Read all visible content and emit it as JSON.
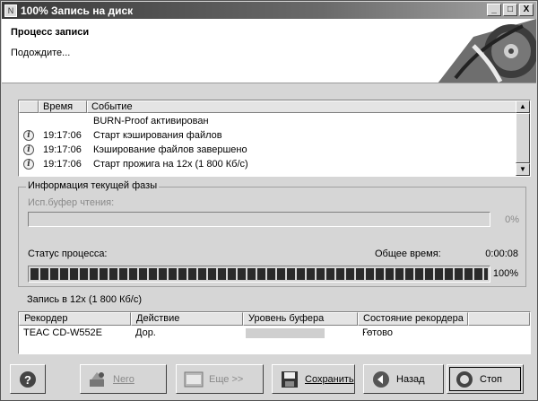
{
  "window": {
    "title": "100% Запись на диск",
    "controls": {
      "minimize": "_",
      "maximize": "□",
      "close": "X"
    }
  },
  "header": {
    "title": "Процесс записи",
    "subtitle": "Подождите..."
  },
  "log": {
    "columns": [
      "Время",
      "Событие"
    ],
    "rows": [
      {
        "icon": "",
        "time": "",
        "event": "BURN-Proof активирован"
      },
      {
        "icon": "info-icon",
        "time": "19:17:06",
        "event": "Старт кэширования файлов"
      },
      {
        "icon": "info-icon",
        "time": "19:17:06",
        "event": "Кэширование файлов завершено"
      },
      {
        "icon": "info-icon",
        "time": "19:17:06",
        "event": "Старт прожига на 12x (1 800 Кб/с)"
      }
    ]
  },
  "phase": {
    "legend": "Информация текущей фазы",
    "read_buffer_label": "Исп.буфер чтения:",
    "read_buffer_percent": "0%",
    "read_buffer_value": 0,
    "status_label": "Статус процесса:",
    "total_time_label": "Общее время:",
    "total_time": "0:00:08",
    "progress_percent": "100%",
    "progress_value": 1.0
  },
  "status_line": "Запись в 12x (1 800 Кб/с)",
  "recorders": {
    "columns": [
      "Рекордер",
      "Действие",
      "Уровень буфера",
      "Состояние рекордера ..."
    ],
    "rows": [
      {
        "recorder": "TEAC CD-W552E",
        "action": "Дор.",
        "buffer_level": 1.0,
        "state": "Готово"
      }
    ]
  },
  "buttons": {
    "help": "",
    "nero": "Nero",
    "more": "Еще >>",
    "save": "Сохранить",
    "back": "Назад",
    "stop": "Стоп"
  }
}
